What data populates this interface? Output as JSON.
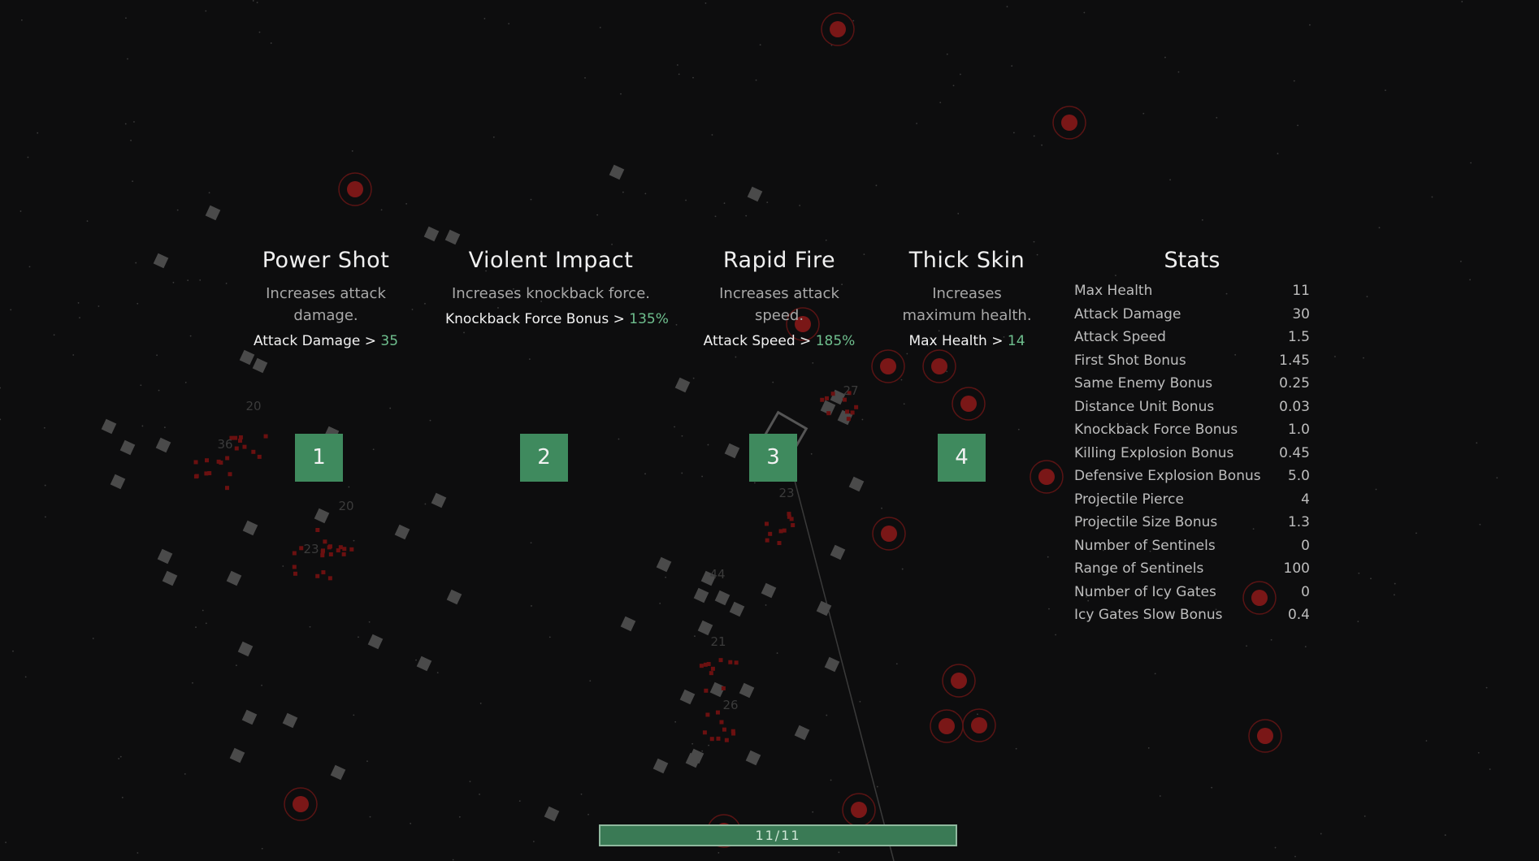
{
  "upgrades": [
    {
      "title": "Power Shot",
      "description": "Increases attack damage.",
      "bonus_label": "Attack Damage >",
      "bonus_value": "35",
      "key": "1"
    },
    {
      "title": "Violent Impact",
      "description": "Increases knockback force.",
      "bonus_label": "Knockback Force Bonus >",
      "bonus_value": "135%",
      "key": "2"
    },
    {
      "title": "Rapid Fire",
      "description": "Increases attack speed.",
      "bonus_label": "Attack Speed >",
      "bonus_value": "185%",
      "key": "3"
    },
    {
      "title": "Thick Skin",
      "description": "Increases maximum health.",
      "bonus_label": "Max Health >",
      "bonus_value": "14",
      "key": "4"
    }
  ],
  "stats": {
    "title": "Stats",
    "rows": [
      {
        "label": "Max Health",
        "value": "11"
      },
      {
        "label": "Attack Damage",
        "value": "30"
      },
      {
        "label": "Attack Speed",
        "value": "1.5"
      },
      {
        "label": "First Shot Bonus",
        "value": "1.45"
      },
      {
        "label": "Same Enemy Bonus",
        "value": "0.25"
      },
      {
        "label": "Distance Unit Bonus",
        "value": "0.03"
      },
      {
        "label": "Knockback Force Bonus",
        "value": "1.0"
      },
      {
        "label": "Killing Explosion Bonus",
        "value": "0.45"
      },
      {
        "label": "Defensive Explosion Bonus",
        "value": "5.0"
      },
      {
        "label": "Projectile Pierce",
        "value": "4"
      },
      {
        "label": "Projectile Size Bonus",
        "value": "1.3"
      },
      {
        "label": "Number of Sentinels",
        "value": "0"
      },
      {
        "label": "Range of Sentinels",
        "value": "100"
      },
      {
        "label": "Number of Icy Gates",
        "value": "0"
      },
      {
        "label": "Icy Gates Slow Bonus",
        "value": "0.4"
      }
    ]
  },
  "progress": {
    "text": "11/11",
    "fraction": 1.0
  },
  "damage_numbers": [
    "20",
    "36",
    "20",
    "23",
    "23",
    "44",
    "21",
    "26",
    "27"
  ],
  "colors": {
    "background": "#0d0d0e",
    "accent_green": "#3f8a5e",
    "bonus_green": "#6fbf8e",
    "enemy_red": "#8b1a1a"
  }
}
